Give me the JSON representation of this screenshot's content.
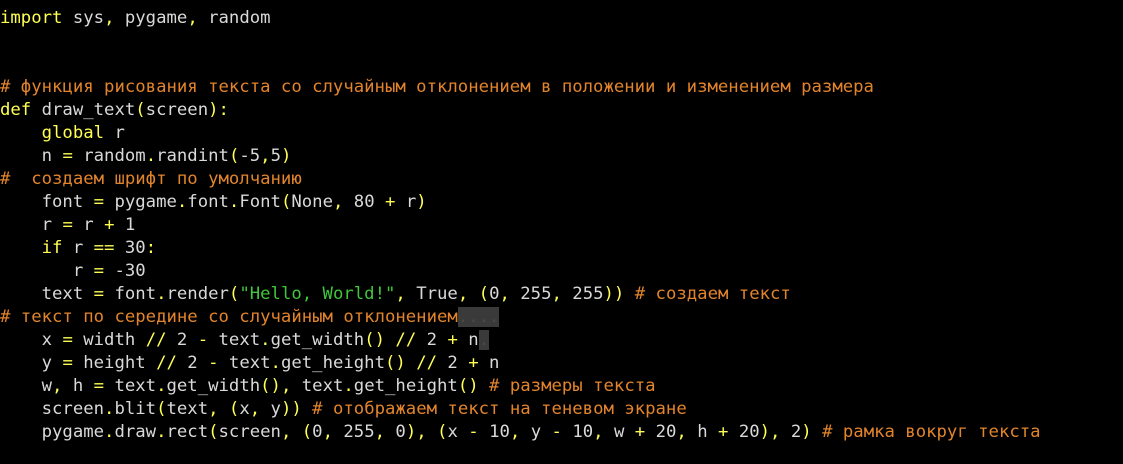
{
  "editor": {
    "lines": [
      [
        {
          "t": "import",
          "k": "kw"
        },
        {
          "t": " sys",
          "k": "pl"
        },
        {
          "t": ",",
          "k": "op"
        },
        {
          "t": " pygame",
          "k": "pl"
        },
        {
          "t": ",",
          "k": "op"
        },
        {
          "t": " random",
          "k": "pl"
        }
      ],
      [],
      [],
      [
        {
          "t": "# функция рисования текста со случайным отклонением в положении и изменением размера",
          "k": "cm"
        }
      ],
      [
        {
          "t": "def",
          "k": "kw"
        },
        {
          "t": " draw_text",
          "k": "pl"
        },
        {
          "t": "(",
          "k": "op"
        },
        {
          "t": "screen",
          "k": "pl"
        },
        {
          "t": "):",
          "k": "op"
        }
      ],
      [
        {
          "t": "    ",
          "k": "pl"
        },
        {
          "t": "global",
          "k": "kw"
        },
        {
          "t": " r",
          "k": "pl"
        }
      ],
      [
        {
          "t": "    n ",
          "k": "pl"
        },
        {
          "t": "=",
          "k": "op"
        },
        {
          "t": " random",
          "k": "pl"
        },
        {
          "t": ".",
          "k": "op"
        },
        {
          "t": "randint",
          "k": "pl"
        },
        {
          "t": "(",
          "k": "op"
        },
        {
          "t": "-5",
          "k": "pl"
        },
        {
          "t": ",",
          "k": "op"
        },
        {
          "t": "5",
          "k": "pl"
        },
        {
          "t": ")",
          "k": "op"
        }
      ],
      [
        {
          "t": "#  создаем шрифт по умолчанию",
          "k": "cm"
        }
      ],
      [
        {
          "t": "    font ",
          "k": "pl"
        },
        {
          "t": "=",
          "k": "op"
        },
        {
          "t": " pygame",
          "k": "pl"
        },
        {
          "t": ".",
          "k": "op"
        },
        {
          "t": "font",
          "k": "pl"
        },
        {
          "t": ".",
          "k": "op"
        },
        {
          "t": "Font",
          "k": "pl"
        },
        {
          "t": "(",
          "k": "op"
        },
        {
          "t": "None",
          "k": "pl"
        },
        {
          "t": ",",
          "k": "op"
        },
        {
          "t": " 80 ",
          "k": "pl"
        },
        {
          "t": "+",
          "k": "op"
        },
        {
          "t": " r",
          "k": "pl"
        },
        {
          "t": ")",
          "k": "op"
        }
      ],
      [
        {
          "t": "    r ",
          "k": "pl"
        },
        {
          "t": "=",
          "k": "op"
        },
        {
          "t": " r ",
          "k": "pl"
        },
        {
          "t": "+",
          "k": "op"
        },
        {
          "t": " 1",
          "k": "pl"
        }
      ],
      [
        {
          "t": "    ",
          "k": "pl"
        },
        {
          "t": "if",
          "k": "kw"
        },
        {
          "t": " r ",
          "k": "pl"
        },
        {
          "t": "==",
          "k": "op"
        },
        {
          "t": " 30",
          "k": "pl"
        },
        {
          "t": ":",
          "k": "op"
        }
      ],
      [
        {
          "t": "       r ",
          "k": "pl"
        },
        {
          "t": "=",
          "k": "op"
        },
        {
          "t": " -30",
          "k": "pl"
        }
      ],
      [
        {
          "t": "    text ",
          "k": "pl"
        },
        {
          "t": "=",
          "k": "op"
        },
        {
          "t": " font",
          "k": "pl"
        },
        {
          "t": ".",
          "k": "op"
        },
        {
          "t": "render",
          "k": "pl"
        },
        {
          "t": "(",
          "k": "op"
        },
        {
          "t": "\"Hello, World!\"",
          "k": "st"
        },
        {
          "t": ",",
          "k": "op"
        },
        {
          "t": " True",
          "k": "pl"
        },
        {
          "t": ",",
          "k": "op"
        },
        {
          "t": " ",
          "k": "pl"
        },
        {
          "t": "(",
          "k": "op"
        },
        {
          "t": "0",
          "k": "pl"
        },
        {
          "t": ",",
          "k": "op"
        },
        {
          "t": " 255",
          "k": "pl"
        },
        {
          "t": ",",
          "k": "op"
        },
        {
          "t": " 255",
          "k": "pl"
        },
        {
          "t": "))",
          "k": "op"
        },
        {
          "t": " # создаем текст",
          "k": "cm"
        }
      ],
      [
        {
          "t": "# текст по середине со случайным отклонением",
          "k": "cm"
        },
        {
          "t": "....",
          "k": "hl"
        }
      ],
      [
        {
          "t": "    x ",
          "k": "pl"
        },
        {
          "t": "=",
          "k": "op"
        },
        {
          "t": " width ",
          "k": "pl"
        },
        {
          "t": "//",
          "k": "op"
        },
        {
          "t": " 2 ",
          "k": "pl"
        },
        {
          "t": "-",
          "k": "op"
        },
        {
          "t": " text",
          "k": "pl"
        },
        {
          "t": ".",
          "k": "op"
        },
        {
          "t": "get_width",
          "k": "pl"
        },
        {
          "t": "()",
          "k": "op"
        },
        {
          "t": " ",
          "k": "pl"
        },
        {
          "t": "//",
          "k": "op"
        },
        {
          "t": " 2 ",
          "k": "pl"
        },
        {
          "t": "+",
          "k": "op"
        },
        {
          "t": " n",
          "k": "pl"
        },
        {
          "t": ".",
          "k": "hl"
        }
      ],
      [
        {
          "t": "    y ",
          "k": "pl"
        },
        {
          "t": "=",
          "k": "op"
        },
        {
          "t": " height ",
          "k": "pl"
        },
        {
          "t": "//",
          "k": "op"
        },
        {
          "t": " 2 ",
          "k": "pl"
        },
        {
          "t": "-",
          "k": "op"
        },
        {
          "t": " text",
          "k": "pl"
        },
        {
          "t": ".",
          "k": "op"
        },
        {
          "t": "get_height",
          "k": "pl"
        },
        {
          "t": "()",
          "k": "op"
        },
        {
          "t": " ",
          "k": "pl"
        },
        {
          "t": "//",
          "k": "op"
        },
        {
          "t": " 2 ",
          "k": "pl"
        },
        {
          "t": "+",
          "k": "op"
        },
        {
          "t": " n",
          "k": "pl"
        }
      ],
      [
        {
          "t": "    w",
          "k": "pl"
        },
        {
          "t": ",",
          "k": "op"
        },
        {
          "t": " h ",
          "k": "pl"
        },
        {
          "t": "=",
          "k": "op"
        },
        {
          "t": " text",
          "k": "pl"
        },
        {
          "t": ".",
          "k": "op"
        },
        {
          "t": "get_width",
          "k": "pl"
        },
        {
          "t": "(),",
          "k": "op"
        },
        {
          "t": " text",
          "k": "pl"
        },
        {
          "t": ".",
          "k": "op"
        },
        {
          "t": "get_height",
          "k": "pl"
        },
        {
          "t": "()",
          "k": "op"
        },
        {
          "t": " # размеры текста",
          "k": "cm"
        }
      ],
      [
        {
          "t": "    screen",
          "k": "pl"
        },
        {
          "t": ".",
          "k": "op"
        },
        {
          "t": "blit",
          "k": "pl"
        },
        {
          "t": "(",
          "k": "op"
        },
        {
          "t": "text",
          "k": "pl"
        },
        {
          "t": ",",
          "k": "op"
        },
        {
          "t": " ",
          "k": "pl"
        },
        {
          "t": "(",
          "k": "op"
        },
        {
          "t": "x",
          "k": "pl"
        },
        {
          "t": ",",
          "k": "op"
        },
        {
          "t": " y",
          "k": "pl"
        },
        {
          "t": "))",
          "k": "op"
        },
        {
          "t": " # отображаем текст на теневом экране",
          "k": "cm"
        }
      ],
      [
        {
          "t": "    pygame",
          "k": "pl"
        },
        {
          "t": ".",
          "k": "op"
        },
        {
          "t": "draw",
          "k": "pl"
        },
        {
          "t": ".",
          "k": "op"
        },
        {
          "t": "rect",
          "k": "pl"
        },
        {
          "t": "(",
          "k": "op"
        },
        {
          "t": "screen",
          "k": "pl"
        },
        {
          "t": ",",
          "k": "op"
        },
        {
          "t": " ",
          "k": "pl"
        },
        {
          "t": "(",
          "k": "op"
        },
        {
          "t": "0",
          "k": "pl"
        },
        {
          "t": ",",
          "k": "op"
        },
        {
          "t": " 255",
          "k": "pl"
        },
        {
          "t": ",",
          "k": "op"
        },
        {
          "t": " 0",
          "k": "pl"
        },
        {
          "t": "),",
          "k": "op"
        },
        {
          "t": " ",
          "k": "pl"
        },
        {
          "t": "(",
          "k": "op"
        },
        {
          "t": "x ",
          "k": "pl"
        },
        {
          "t": "-",
          "k": "op"
        },
        {
          "t": " 10",
          "k": "pl"
        },
        {
          "t": ",",
          "k": "op"
        },
        {
          "t": " y ",
          "k": "pl"
        },
        {
          "t": "-",
          "k": "op"
        },
        {
          "t": " 10",
          "k": "pl"
        },
        {
          "t": ",",
          "k": "op"
        },
        {
          "t": " w ",
          "k": "pl"
        },
        {
          "t": "+",
          "k": "op"
        },
        {
          "t": " 20",
          "k": "pl"
        },
        {
          "t": ",",
          "k": "op"
        },
        {
          "t": " h ",
          "k": "pl"
        },
        {
          "t": "+",
          "k": "op"
        },
        {
          "t": " 20",
          "k": "pl"
        },
        {
          "t": "),",
          "k": "op"
        },
        {
          "t": " 2",
          "k": "pl"
        },
        {
          "t": ")",
          "k": "op"
        },
        {
          "t": " # рамка вокруг текста",
          "k": "cm"
        }
      ]
    ],
    "colors": {
      "background": "#000000",
      "keyword": "#ffff54",
      "comment": "#e2842c",
      "string": "#41c63b",
      "plain": "#d9d9d9"
    }
  }
}
